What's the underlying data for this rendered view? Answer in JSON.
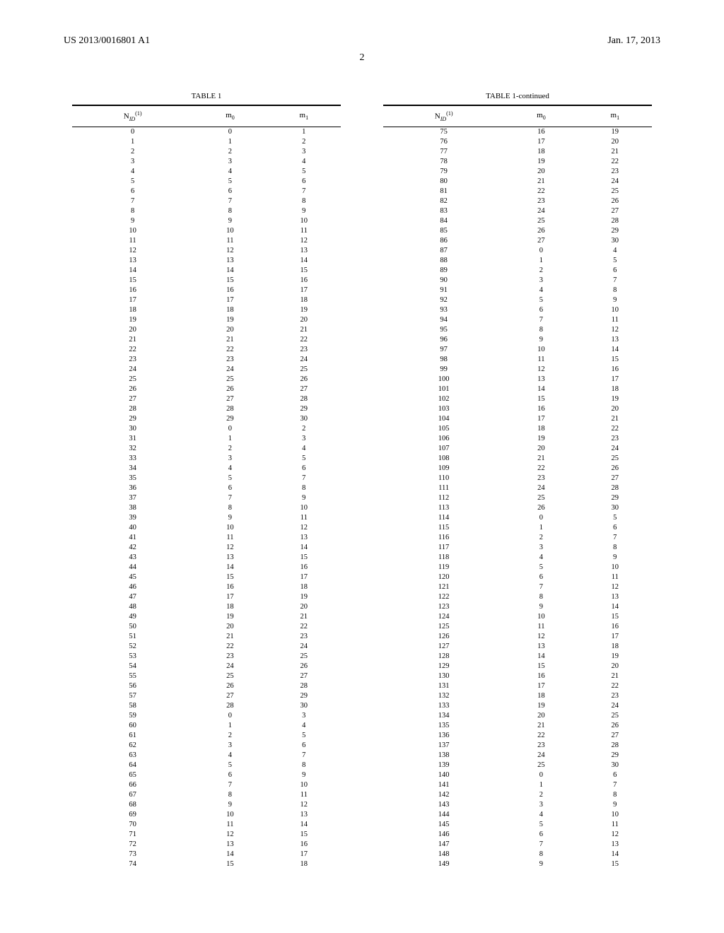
{
  "header": {
    "left": "US 2013/0016801 A1",
    "right": "Jan. 17, 2013"
  },
  "page_number": "2",
  "tables": {
    "left": {
      "title": "TABLE 1",
      "headers": [
        "N_ID^(1)",
        "m_0",
        "m_1"
      ],
      "rows": [
        [
          0,
          0,
          1
        ],
        [
          1,
          1,
          2
        ],
        [
          2,
          2,
          3
        ],
        [
          3,
          3,
          4
        ],
        [
          4,
          4,
          5
        ],
        [
          5,
          5,
          6
        ],
        [
          6,
          6,
          7
        ],
        [
          7,
          7,
          8
        ],
        [
          8,
          8,
          9
        ],
        [
          9,
          9,
          10
        ],
        [
          10,
          10,
          11
        ],
        [
          11,
          11,
          12
        ],
        [
          12,
          12,
          13
        ],
        [
          13,
          13,
          14
        ],
        [
          14,
          14,
          15
        ],
        [
          15,
          15,
          16
        ],
        [
          16,
          16,
          17
        ],
        [
          17,
          17,
          18
        ],
        [
          18,
          18,
          19
        ],
        [
          19,
          19,
          20
        ],
        [
          20,
          20,
          21
        ],
        [
          21,
          21,
          22
        ],
        [
          22,
          22,
          23
        ],
        [
          23,
          23,
          24
        ],
        [
          24,
          24,
          25
        ],
        [
          25,
          25,
          26
        ],
        [
          26,
          26,
          27
        ],
        [
          27,
          27,
          28
        ],
        [
          28,
          28,
          29
        ],
        [
          29,
          29,
          30
        ],
        [
          30,
          0,
          2
        ],
        [
          31,
          1,
          3
        ],
        [
          32,
          2,
          4
        ],
        [
          33,
          3,
          5
        ],
        [
          34,
          4,
          6
        ],
        [
          35,
          5,
          7
        ],
        [
          36,
          6,
          8
        ],
        [
          37,
          7,
          9
        ],
        [
          38,
          8,
          10
        ],
        [
          39,
          9,
          11
        ],
        [
          40,
          10,
          12
        ],
        [
          41,
          11,
          13
        ],
        [
          42,
          12,
          14
        ],
        [
          43,
          13,
          15
        ],
        [
          44,
          14,
          16
        ],
        [
          45,
          15,
          17
        ],
        [
          46,
          16,
          18
        ],
        [
          47,
          17,
          19
        ],
        [
          48,
          18,
          20
        ],
        [
          49,
          19,
          21
        ],
        [
          50,
          20,
          22
        ],
        [
          51,
          21,
          23
        ],
        [
          52,
          22,
          24
        ],
        [
          53,
          23,
          25
        ],
        [
          54,
          24,
          26
        ],
        [
          55,
          25,
          27
        ],
        [
          56,
          26,
          28
        ],
        [
          57,
          27,
          29
        ],
        [
          58,
          28,
          30
        ],
        [
          59,
          0,
          3
        ],
        [
          60,
          1,
          4
        ],
        [
          61,
          2,
          5
        ],
        [
          62,
          3,
          6
        ],
        [
          63,
          4,
          7
        ],
        [
          64,
          5,
          8
        ],
        [
          65,
          6,
          9
        ],
        [
          66,
          7,
          10
        ],
        [
          67,
          8,
          11
        ],
        [
          68,
          9,
          12
        ],
        [
          69,
          10,
          13
        ],
        [
          70,
          11,
          14
        ],
        [
          71,
          12,
          15
        ],
        [
          72,
          13,
          16
        ],
        [
          73,
          14,
          17
        ],
        [
          74,
          15,
          18
        ]
      ]
    },
    "right": {
      "title": "TABLE 1-continued",
      "headers": [
        "N_ID^(1)",
        "m_0",
        "m_1"
      ],
      "rows": [
        [
          75,
          16,
          19
        ],
        [
          76,
          17,
          20
        ],
        [
          77,
          18,
          21
        ],
        [
          78,
          19,
          22
        ],
        [
          79,
          20,
          23
        ],
        [
          80,
          21,
          24
        ],
        [
          81,
          22,
          25
        ],
        [
          82,
          23,
          26
        ],
        [
          83,
          24,
          27
        ],
        [
          84,
          25,
          28
        ],
        [
          85,
          26,
          29
        ],
        [
          86,
          27,
          30
        ],
        [
          87,
          0,
          4
        ],
        [
          88,
          1,
          5
        ],
        [
          89,
          2,
          6
        ],
        [
          90,
          3,
          7
        ],
        [
          91,
          4,
          8
        ],
        [
          92,
          5,
          9
        ],
        [
          93,
          6,
          10
        ],
        [
          94,
          7,
          11
        ],
        [
          95,
          8,
          12
        ],
        [
          96,
          9,
          13
        ],
        [
          97,
          10,
          14
        ],
        [
          98,
          11,
          15
        ],
        [
          99,
          12,
          16
        ],
        [
          100,
          13,
          17
        ],
        [
          101,
          14,
          18
        ],
        [
          102,
          15,
          19
        ],
        [
          103,
          16,
          20
        ],
        [
          104,
          17,
          21
        ],
        [
          105,
          18,
          22
        ],
        [
          106,
          19,
          23
        ],
        [
          107,
          20,
          24
        ],
        [
          108,
          21,
          25
        ],
        [
          109,
          22,
          26
        ],
        [
          110,
          23,
          27
        ],
        [
          111,
          24,
          28
        ],
        [
          112,
          25,
          29
        ],
        [
          113,
          26,
          30
        ],
        [
          114,
          0,
          5
        ],
        [
          115,
          1,
          6
        ],
        [
          116,
          2,
          7
        ],
        [
          117,
          3,
          8
        ],
        [
          118,
          4,
          9
        ],
        [
          119,
          5,
          10
        ],
        [
          120,
          6,
          11
        ],
        [
          121,
          7,
          12
        ],
        [
          122,
          8,
          13
        ],
        [
          123,
          9,
          14
        ],
        [
          124,
          10,
          15
        ],
        [
          125,
          11,
          16
        ],
        [
          126,
          12,
          17
        ],
        [
          127,
          13,
          18
        ],
        [
          128,
          14,
          19
        ],
        [
          129,
          15,
          20
        ],
        [
          130,
          16,
          21
        ],
        [
          131,
          17,
          22
        ],
        [
          132,
          18,
          23
        ],
        [
          133,
          19,
          24
        ],
        [
          134,
          20,
          25
        ],
        [
          135,
          21,
          26
        ],
        [
          136,
          22,
          27
        ],
        [
          137,
          23,
          28
        ],
        [
          138,
          24,
          29
        ],
        [
          139,
          25,
          30
        ],
        [
          140,
          0,
          6
        ],
        [
          141,
          1,
          7
        ],
        [
          142,
          2,
          8
        ],
        [
          143,
          3,
          9
        ],
        [
          144,
          4,
          10
        ],
        [
          145,
          5,
          11
        ],
        [
          146,
          6,
          12
        ],
        [
          147,
          7,
          13
        ],
        [
          148,
          8,
          14
        ],
        [
          149,
          9,
          15
        ]
      ]
    }
  }
}
